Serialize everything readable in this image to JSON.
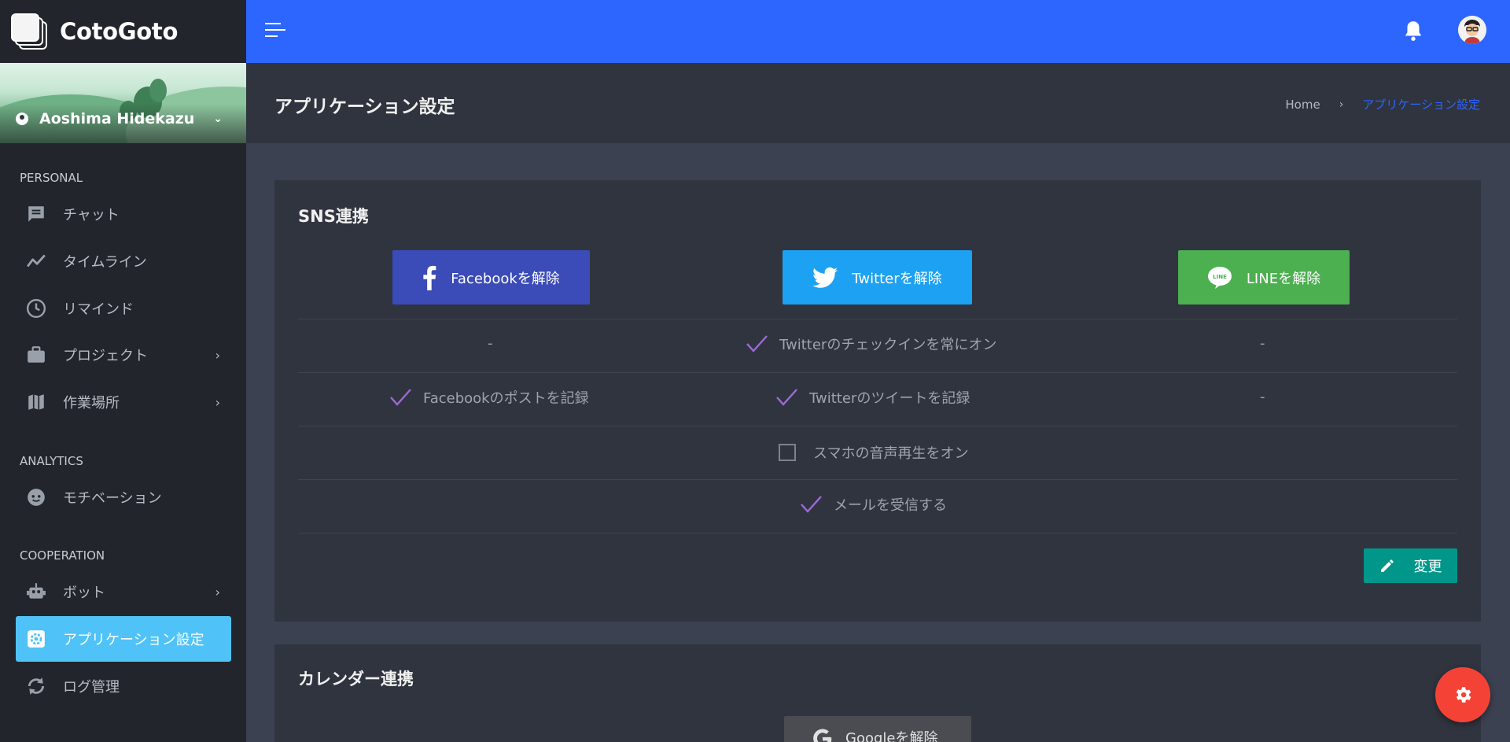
{
  "app": {
    "name": "CotoGoto"
  },
  "profile": {
    "user_name": "Aoshima Hidekazu"
  },
  "sidebar": {
    "sections": [
      {
        "label": "PERSONAL"
      },
      {
        "label": "ANALYTICS"
      },
      {
        "label": "COOPERATION"
      }
    ],
    "items": [
      {
        "label": "チャット",
        "icon": "chat-icon"
      },
      {
        "label": "タイムライン",
        "icon": "timeline-icon"
      },
      {
        "label": "リマインド",
        "icon": "clock-icon"
      },
      {
        "label": "プロジェクト",
        "icon": "briefcase-icon",
        "has_children": true
      },
      {
        "label": "作業場所",
        "icon": "map-icon",
        "has_children": true
      },
      {
        "label": "モチベーション",
        "icon": "face-icon"
      },
      {
        "label": "ボット",
        "icon": "robot-icon",
        "has_children": true
      },
      {
        "label": "アプリケーション設定",
        "icon": "settings-icon",
        "active": true
      },
      {
        "label": "ログ管理",
        "icon": "sync-icon"
      }
    ]
  },
  "header": {
    "title": "アプリケーション設定",
    "breadcrumb": {
      "home": "Home",
      "current": "アプリケーション設定"
    }
  },
  "sns": {
    "title": "SNS連携",
    "buttons": {
      "facebook": {
        "label": "Facebookを解除",
        "color": "#3b4cb8"
      },
      "twitter": {
        "label": "Twitterを解除",
        "color": "#1da1f2"
      },
      "line": {
        "label": "LINEを解除",
        "color": "#4caf50"
      }
    },
    "rows": {
      "r1_fb": "-",
      "r1_tw": "Twitterのチェックインを常にオン",
      "r1_line": "-",
      "r2_fb": "Facebookのポストを記録",
      "r2_tw": "Twitterのツイートを記録",
      "r2_line": "-",
      "r3": "スマホの音声再生をオン",
      "r4": "メールを受信する"
    },
    "change_label": "変更"
  },
  "calendar": {
    "title": "カレンダー連携",
    "google_label": "Googleを解除"
  },
  "colors": {
    "accent": "#2d66ff",
    "sidebar_active": "#4fc3f7",
    "check": "#9c6ad6",
    "fab": "#f44336",
    "change_button": "#00968a"
  }
}
